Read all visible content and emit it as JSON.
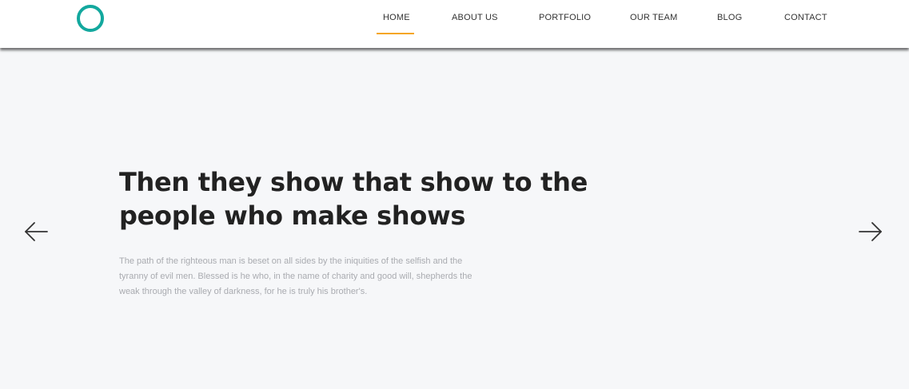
{
  "header": {
    "nav": [
      {
        "label": "HOME",
        "active": true
      },
      {
        "label": "ABOUT US"
      },
      {
        "label": "PORTFOLIO"
      },
      {
        "label": "OUR TEAM"
      },
      {
        "label": "BLOG"
      },
      {
        "label": "CONTACT"
      }
    ]
  },
  "hero": {
    "title": "Then they show that show to the people who make shows",
    "text": "The path of the righteous man is beset on all sides by the iniquities of the selfish and the tyranny of evil men. Blessed is he who, in the name of charity and good will, shepherds the weak through the valley of darkness, for he is truly his brother's."
  },
  "icons": {
    "logo": "ring-logo-icon",
    "prev": "arrow-left-icon",
    "next": "arrow-right-icon"
  },
  "colors": {
    "accent": "#13a89e",
    "active_underline": "#f5a623",
    "background": "#f6f7f9",
    "heading": "#222222",
    "body_text": "#a9abb0"
  }
}
